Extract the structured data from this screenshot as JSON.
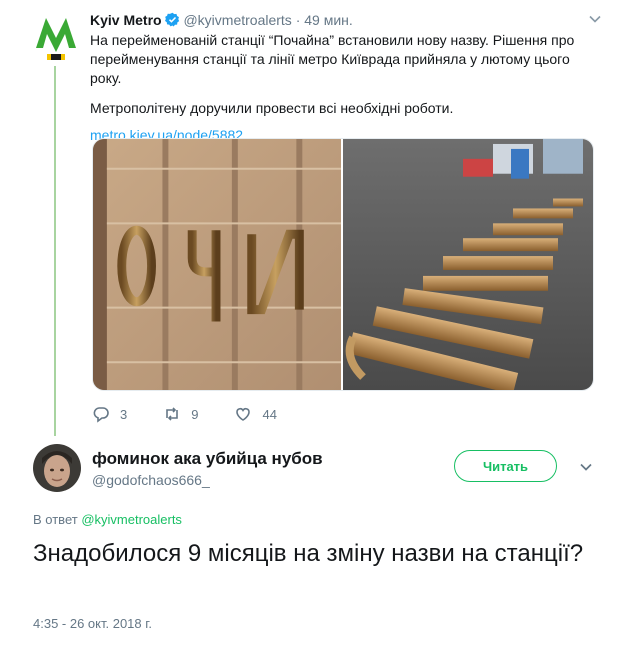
{
  "parent_tweet": {
    "author_name": "Kyiv Metro",
    "handle": "@kyivmetroalerts",
    "separator": "·",
    "time": "49 мин.",
    "text_1": "На перейменованій станції “Почайна” встановили нову назву. Рішення про перейменування станції та лінії метро Київрада прийняла у лютому цього року.",
    "text_2": "Метрополітену доручили провести всі необхідні роботи.",
    "link": "metro.kiev.ua/node/5882",
    "replies": "3",
    "retweets": "9",
    "likes": "44"
  },
  "main_tweet": {
    "author_name": "фоминок ака убийца нубов",
    "handle": "@godofchaos666_",
    "follow_label": "Читать",
    "reply_prefix": "В ответ",
    "reply_mention": "@kyivmetroalerts",
    "text": "Знадобилося 9 місяців на зміну назви на станції?",
    "timestamp": "4:35 - 26 окт. 2018 г."
  },
  "colors": {
    "metro_green": "#3aa935",
    "follow_green": "#17bf63",
    "link_blue": "#1da1f2",
    "muted": "#657786"
  },
  "icons": [
    "metro-logo-icon",
    "verified-icon",
    "chevron-down-icon",
    "reply-icon",
    "retweet-icon",
    "like-icon"
  ]
}
